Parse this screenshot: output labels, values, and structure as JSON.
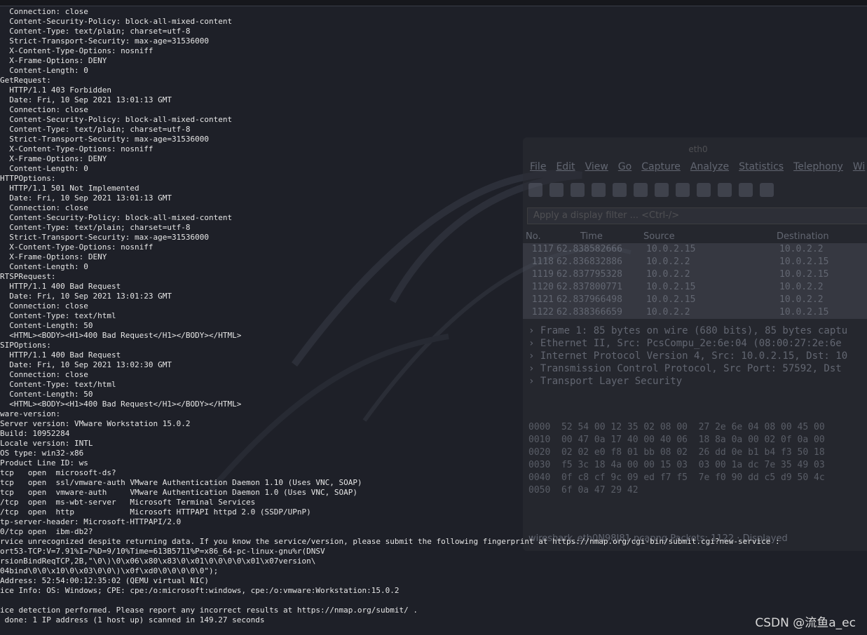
{
  "terminal_lines": [
    "  Connection: close",
    "  Content-Security-Policy: block-all-mixed-content",
    "  Content-Type: text/plain; charset=utf-8",
    "  Strict-Transport-Security: max-age=31536000",
    "  X-Content-Type-Options: nosniff",
    "  X-Frame-Options: DENY",
    "  Content-Length: 0",
    "GetRequest:",
    "  HTTP/1.1 403 Forbidden",
    "  Date: Fri, 10 Sep 2021 13:01:13 GMT",
    "  Connection: close",
    "  Content-Security-Policy: block-all-mixed-content",
    "  Content-Type: text/plain; charset=utf-8",
    "  Strict-Transport-Security: max-age=31536000",
    "  X-Content-Type-Options: nosniff",
    "  X-Frame-Options: DENY",
    "  Content-Length: 0",
    "HTTPOptions:",
    "  HTTP/1.1 501 Not Implemented",
    "  Date: Fri, 10 Sep 2021 13:01:13 GMT",
    "  Connection: close",
    "  Content-Security-Policy: block-all-mixed-content",
    "  Content-Type: text/plain; charset=utf-8",
    "  Strict-Transport-Security: max-age=31536000",
    "  X-Content-Type-Options: nosniff",
    "  X-Frame-Options: DENY",
    "  Content-Length: 0",
    "RTSPRequest:",
    "  HTTP/1.1 400 Bad Request",
    "  Date: Fri, 10 Sep 2021 13:01:23 GMT",
    "  Connection: close",
    "  Content-Type: text/html",
    "  Content-Length: 50",
    "  <HTML><BODY><H1>400 Bad Request</H1></BODY></HTML>",
    "SIPOptions:",
    "  HTTP/1.1 400 Bad Request",
    "  Date: Fri, 10 Sep 2021 13:02:30 GMT",
    "  Connection: close",
    "  Content-Type: text/html",
    "  Content-Length: 50",
    "  <HTML><BODY><H1>400 Bad Request</H1></BODY></HTML>",
    "ware-version:",
    "Server version: VMware Workstation 15.0.2",
    "Build: 10952284",
    "Locale version: INTL",
    "OS type: win32-x86",
    "Product Line ID: ws",
    "tcp   open  microsoft-ds?",
    "tcp   open  ssl/vmware-auth VMware Authentication Daemon 1.10 (Uses VNC, SOAP)",
    "tcp   open  vmware-auth     VMware Authentication Daemon 1.0 (Uses VNC, SOAP)",
    "/tcp  open  ms-wbt-server   Microsoft Terminal Services",
    "/tcp  open  http            Microsoft HTTPAPI httpd 2.0 (SSDP/UPnP)",
    "tp-server-header: Microsoft-HTTPAPI/2.0",
    "0/tcp open  ibm-db2?",
    "rvice unrecognized despite returning data. If you know the service/version, please submit the following fingerprint at https://nmap.org/cgi-bin/submit.cgi?new-service :",
    "ort53-TCP:V=7.91%I=7%D=9/10%Time=613B5711%P=x86_64-pc-linux-gnu%r(DNSV",
    "rsionBindReqTCP,2B,\"\\0\\)\\0\\x06\\x80\\x83\\0\\x01\\0\\0\\0\\0\\x01\\x07version\\",
    "04bind\\0\\0\\x10\\0\\x03\\0\\0\\)\\x0f\\xd0\\0\\0\\0\\0\\0\");",
    "Address: 52:54:00:12:35:02 (QEMU virtual NIC)",
    "ice Info: OS: Windows; CPE: cpe:/o:microsoft:windows, cpe:/o:vmware:Workstation:15.0.2",
    "",
    "ice detection performed. Please report any incorrect results at https://nmap.org/submit/ .",
    " done: 1 IP address (1 host up) scanned in 149.27 seconds"
  ],
  "wireshark": {
    "title": "eth0",
    "menu": [
      "File",
      "Edit",
      "View",
      "Go",
      "Capture",
      "Analyze",
      "Statistics",
      "Telephony",
      "Wi"
    ],
    "filter_placeholder": "Apply a display filter ... <Ctrl-/>",
    "columns": [
      "No.",
      "Time",
      "Source",
      "Destination"
    ],
    "packets": [
      [
        "1117",
        "62.838582666",
        "10.0.2.15",
        "10.0.2.2"
      ],
      [
        "1118",
        "62.836832886",
        "10.0.2.2",
        "10.0.2.15"
      ],
      [
        "1119",
        "62.837795328",
        "10.0.2.2",
        "10.0.2.15"
      ],
      [
        "1120",
        "62.837800771",
        "10.0.2.15",
        "10.0.2.2"
      ],
      [
        "1121",
        "62.837966498",
        "10.0.2.15",
        "10.0.2.2"
      ],
      [
        "1122",
        "62.838366659",
        "10.0.2.2",
        "10.0.2.15"
      ]
    ],
    "details": [
      "› Frame 1: 85 bytes on wire (680 bits), 85 bytes captu",
      "› Ethernet II, Src: PcsCompu_2e:6e:04 (08:00:27:2e:6e",
      "› Internet Protocol Version 4, Src: 10.0.2.15, Dst: 10",
      "› Transmission Control Protocol, Src Port: 57592, Dst",
      "› Transport Layer Security"
    ],
    "hex_lines": [
      "0000  52 54 00 12 35 02 08 00  27 2e 6e 04 08 00 45 00",
      "0010  00 47 0a 17 40 00 40 06  18 8a 0a 00 02 0f 0a 00",
      "0020  02 02 e0 f8 01 bb 08 02  26 dd 0e b1 b4 f3 50 18",
      "0030  f5 3c 18 4a 00 00 15 03  03 00 1a dc 7e 35 49 03",
      "0040  0f c8 cf 9c 09 ed f7 f5  7e f0 90 dd c5 d9 50 4c",
      "0050  6f 0a 47 29 42"
    ],
    "status": "wireshark_eth0N98J81.pcapng     Packets: 1122 · Displayed"
  },
  "watermark": "CSDN @流鱼a_ec"
}
